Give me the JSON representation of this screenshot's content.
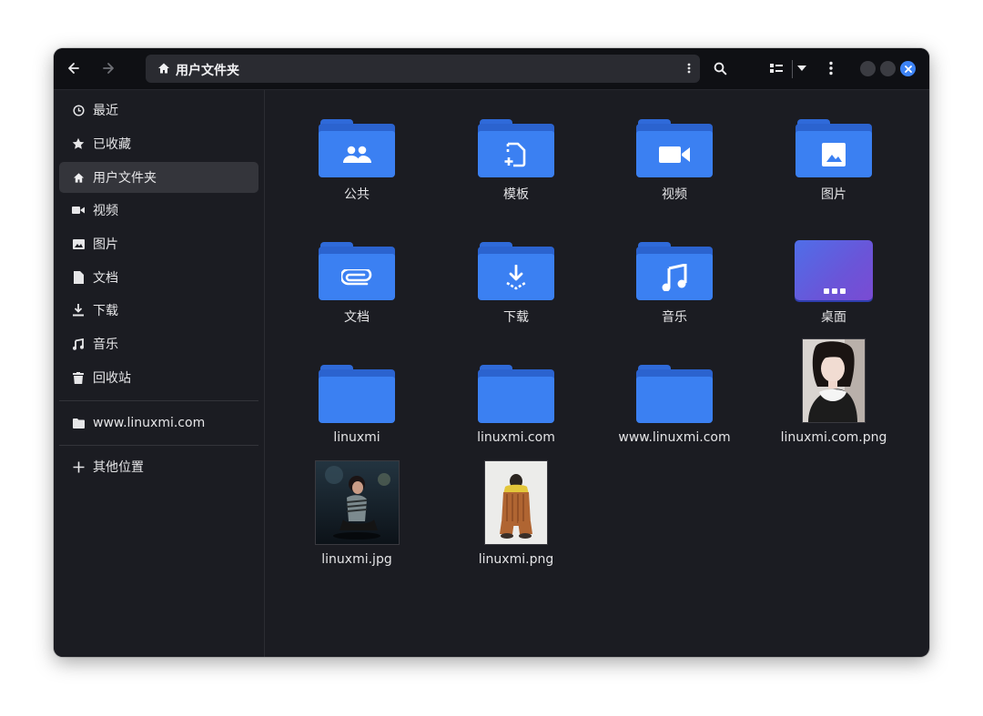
{
  "header": {
    "path_label": "用户文件夹"
  },
  "sidebar": {
    "items": [
      {
        "label": "最近",
        "icon": "clock-icon"
      },
      {
        "label": "已收藏",
        "icon": "star-icon"
      },
      {
        "label": "用户文件夹",
        "icon": "home-icon",
        "active": true
      },
      {
        "label": "视频",
        "icon": "video-icon"
      },
      {
        "label": "图片",
        "icon": "image-icon"
      },
      {
        "label": "文档",
        "icon": "document-icon"
      },
      {
        "label": "下载",
        "icon": "download-icon"
      },
      {
        "label": "音乐",
        "icon": "music-icon"
      },
      {
        "label": "回收站",
        "icon": "trash-icon"
      }
    ],
    "bookmarks": [
      {
        "label": "www.linuxmi.com",
        "icon": "folder-icon"
      }
    ],
    "other_locations": {
      "label": "其他位置",
      "icon": "plus-icon"
    }
  },
  "files": [
    {
      "name": "公共",
      "kind": "folder",
      "emblem": "people-icon"
    },
    {
      "name": "模板",
      "kind": "folder",
      "emblem": "template-icon"
    },
    {
      "name": "视频",
      "kind": "folder",
      "emblem": "video-icon"
    },
    {
      "name": "图片",
      "kind": "folder",
      "emblem": "image-icon"
    },
    {
      "name": "文档",
      "kind": "folder",
      "emblem": "paperclip-icon"
    },
    {
      "name": "下载",
      "kind": "folder",
      "emblem": "download-icon"
    },
    {
      "name": "音乐",
      "kind": "folder",
      "emblem": "music-icon"
    },
    {
      "name": "桌面",
      "kind": "desktop",
      "emblem": "desktop-icon"
    },
    {
      "name": "linuxmi",
      "kind": "folder",
      "emblem": ""
    },
    {
      "name": "linuxmi.com",
      "kind": "folder",
      "emblem": ""
    },
    {
      "name": "www.linuxmi.com",
      "kind": "folder",
      "emblem": ""
    },
    {
      "name": "linuxmi.com.png",
      "kind": "image",
      "emblem": "photo-thumbnail"
    },
    {
      "name": "linuxmi.jpg",
      "kind": "image",
      "emblem": "photo-thumbnail"
    },
    {
      "name": "linuxmi.png",
      "kind": "image",
      "emblem": "photo-thumbnail"
    }
  ],
  "colors": {
    "accent": "#3d83f5",
    "folder": "#3b80f2",
    "window_bg": "#1b1c22",
    "headerbar_bg": "#0f1014"
  }
}
